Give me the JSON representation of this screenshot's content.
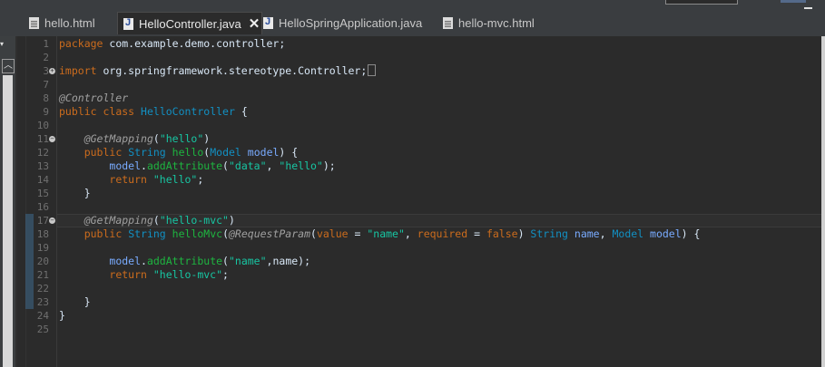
{
  "tabs": [
    {
      "label": "hello.html",
      "icon": "html-file-icon",
      "active": false
    },
    {
      "label": "HelloController.java",
      "icon": "java-file-icon",
      "active": true
    },
    {
      "label": "HelloSpringApplication.java",
      "icon": "java-file-icon",
      "active": false
    },
    {
      "label": "hello-mvc.html",
      "icon": "html-file-icon",
      "active": false
    }
  ],
  "editor": {
    "line_numbers": [
      "1",
      "2",
      "3",
      "7",
      "8",
      "9",
      "10",
      "11",
      "12",
      "13",
      "14",
      "15",
      "16",
      "17",
      "18",
      "19",
      "20",
      "21",
      "22",
      "23",
      "24",
      "25"
    ],
    "code": {
      "l1_kw": "package",
      "l1_rest": " com.example.demo.controller;",
      "l3_kw": "import",
      "l3_rest": " org.springframework.stereotype.Controller;",
      "l8": "@Controller",
      "l9_kw1": "public",
      "l9_kw2": "class",
      "l9_cls": "HelloController",
      "l9_rest": " {",
      "l11_ann": "@GetMapping",
      "l11_str": "\"hello\"",
      "l12_kw": "public",
      "l12_type": "String",
      "l12_meth": "hello",
      "l12_ptype": "Model",
      "l12_pname": "model",
      "l13_var": "model",
      "l13_meth": "addAttribute",
      "l13_s1": "\"data\"",
      "l13_s2": "\"hello\"",
      "l14_kw": "return",
      "l14_str": "\"hello\"",
      "l15": "}",
      "l17_ann": "@GetMapping",
      "l17_str": "\"hello-mvc\"",
      "l18_kw": "public",
      "l18_type": "String",
      "l18_meth": "helloMvc",
      "l18_ann": "@RequestParam",
      "l18_value": "value",
      "l18_s1": "\"name\"",
      "l18_required": "required",
      "l18_false": "false",
      "l18_type2": "String",
      "l18_pname1": "name",
      "l18_ptype": "Model",
      "l18_pname2": "model",
      "l20_var": "model",
      "l20_meth": "addAttribute",
      "l20_s1": "\"name\"",
      "l20_arg": "name",
      "l21_kw": "return",
      "l21_str": "\"hello-mvc\"",
      "l23": "}",
      "l24": "}"
    }
  },
  "colors": {
    "keyword": "#cc6c1d",
    "string": "#17c6a3",
    "class": "#1290c3",
    "method": "#1eb540",
    "annotation": "#a0a0a0",
    "background": "#2b2b2b"
  }
}
